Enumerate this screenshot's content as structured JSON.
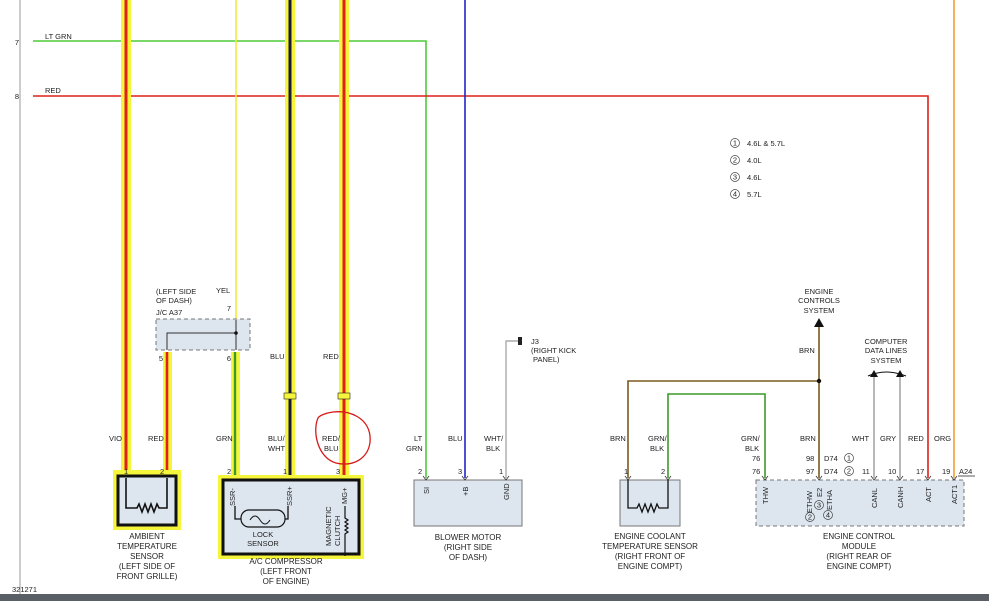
{
  "diagram_id": "321271",
  "row_numbers": {
    "r7": "7",
    "r8": "8"
  },
  "top_wires": {
    "lt_grn": "LT GRN",
    "red": "RED"
  },
  "legend": [
    {
      "num": "1",
      "text": "4.6L & 5.7L"
    },
    {
      "num": "2",
      "text": "4.0L"
    },
    {
      "num": "3",
      "text": "4.6L"
    },
    {
      "num": "4",
      "text": "5.7L"
    }
  ],
  "jc": {
    "l1": "(LEFT SIDE",
    "l2": "OF DASH)",
    "l3": "J/C A37",
    "yel": "YEL",
    "pin7": "7",
    "pin5": "5",
    "pin6": "6"
  },
  "ground": {
    "l1": "J3",
    "l2": "(RIGHT KICK",
    "l3": "PANEL)"
  },
  "ecs": {
    "l1": "ENGINE",
    "l2": "CONTROLS",
    "l3": "SYSTEM"
  },
  "cdl": {
    "l1": "COMPUTER",
    "l2": "DATA LINES",
    "l3": "SYSTEM"
  },
  "mid_wires": {
    "blu": "BLU",
    "red": "RED",
    "brn": "BRN"
  },
  "wire_labels": {
    "vio": "VIO",
    "red": "RED",
    "grn": "GRN",
    "blu_wht_1": "BLU/",
    "blu_wht_2": "WHT",
    "red_blu_1": "RED/",
    "red_blu_2": "BLU",
    "lt_grn_1": "LT",
    "lt_grn_2": "GRN",
    "blu": "BLU",
    "wht_blk_1": "WHT/",
    "wht_blk_2": "BLK",
    "brn": "BRN",
    "grn_blk_1": "GRN/",
    "grn_blk_2": "BLK",
    "grn_blk_ecm_1": "GRN/",
    "grn_blk_ecm_2": "BLK",
    "grn_blk_ecm_3": "76",
    "brn_ecm": "BRN",
    "wht": "WHT",
    "gry": "GRY",
    "red_ecm": "RED",
    "org": "ORG"
  },
  "pins": {
    "amb1": "1",
    "amb2": "2",
    "ac2": "2",
    "ac1": "1",
    "ac3": "3",
    "bl2": "2",
    "bl3": "3",
    "bl1": "1",
    "ect1": "1",
    "ect2": "2",
    "e76": "76",
    "e98": "98",
    "e97": "97",
    "e11": "11",
    "e10": "10",
    "e17": "17",
    "e19": "19",
    "d74a": "D74",
    "d74b": "D74",
    "a24": "A24"
  },
  "terminals": {
    "ssr_minus": "SSR-",
    "ssr_plus": "SSR+",
    "mg_plus": "MG+",
    "si": "SI",
    "plus_b": "+B",
    "gnd": "GND",
    "thw": "THW",
    "ethw": "ETHW",
    "e2": "E2",
    "etha": "ETHA",
    "canl": "CANL",
    "canh": "CANH",
    "act": "ACT",
    "act1": "ACT1"
  },
  "components": {
    "ambient": [
      "AMBIENT",
      "TEMPERATURE",
      "SENSOR",
      "(LEFT SIDE OF",
      "FRONT GRILLE)"
    ],
    "ac": [
      "A/C COMPRESSOR",
      "(LEFT FRONT",
      "OF ENGINE)"
    ],
    "lock": [
      "LOCK",
      "SENSOR"
    ],
    "clutch": [
      "MAGNETIC",
      "CLUTCH"
    ],
    "blower": [
      "BLOWER MOTOR",
      "(RIGHT SIDE",
      "OF DASH)"
    ],
    "ect": [
      "ENGINE COOLANT",
      "TEMPERATURE SENSOR",
      "(RIGHT FRONT OF",
      "ENGINE COMPT)"
    ],
    "ecm": [
      "ENGINE CONTROL",
      "MODULE",
      "(RIGHT REAR OF",
      "ENGINE COMPT)"
    ]
  },
  "colors": {
    "highlight": "#f5f53c",
    "red": "#e0201a",
    "lt_grn": "#4ecb3a",
    "blue": "#2323c8",
    "yellow": "#f2ea3a",
    "brn": "#7a5a1e",
    "org": "#f0a030",
    "gry": "#9a9a9a"
  }
}
